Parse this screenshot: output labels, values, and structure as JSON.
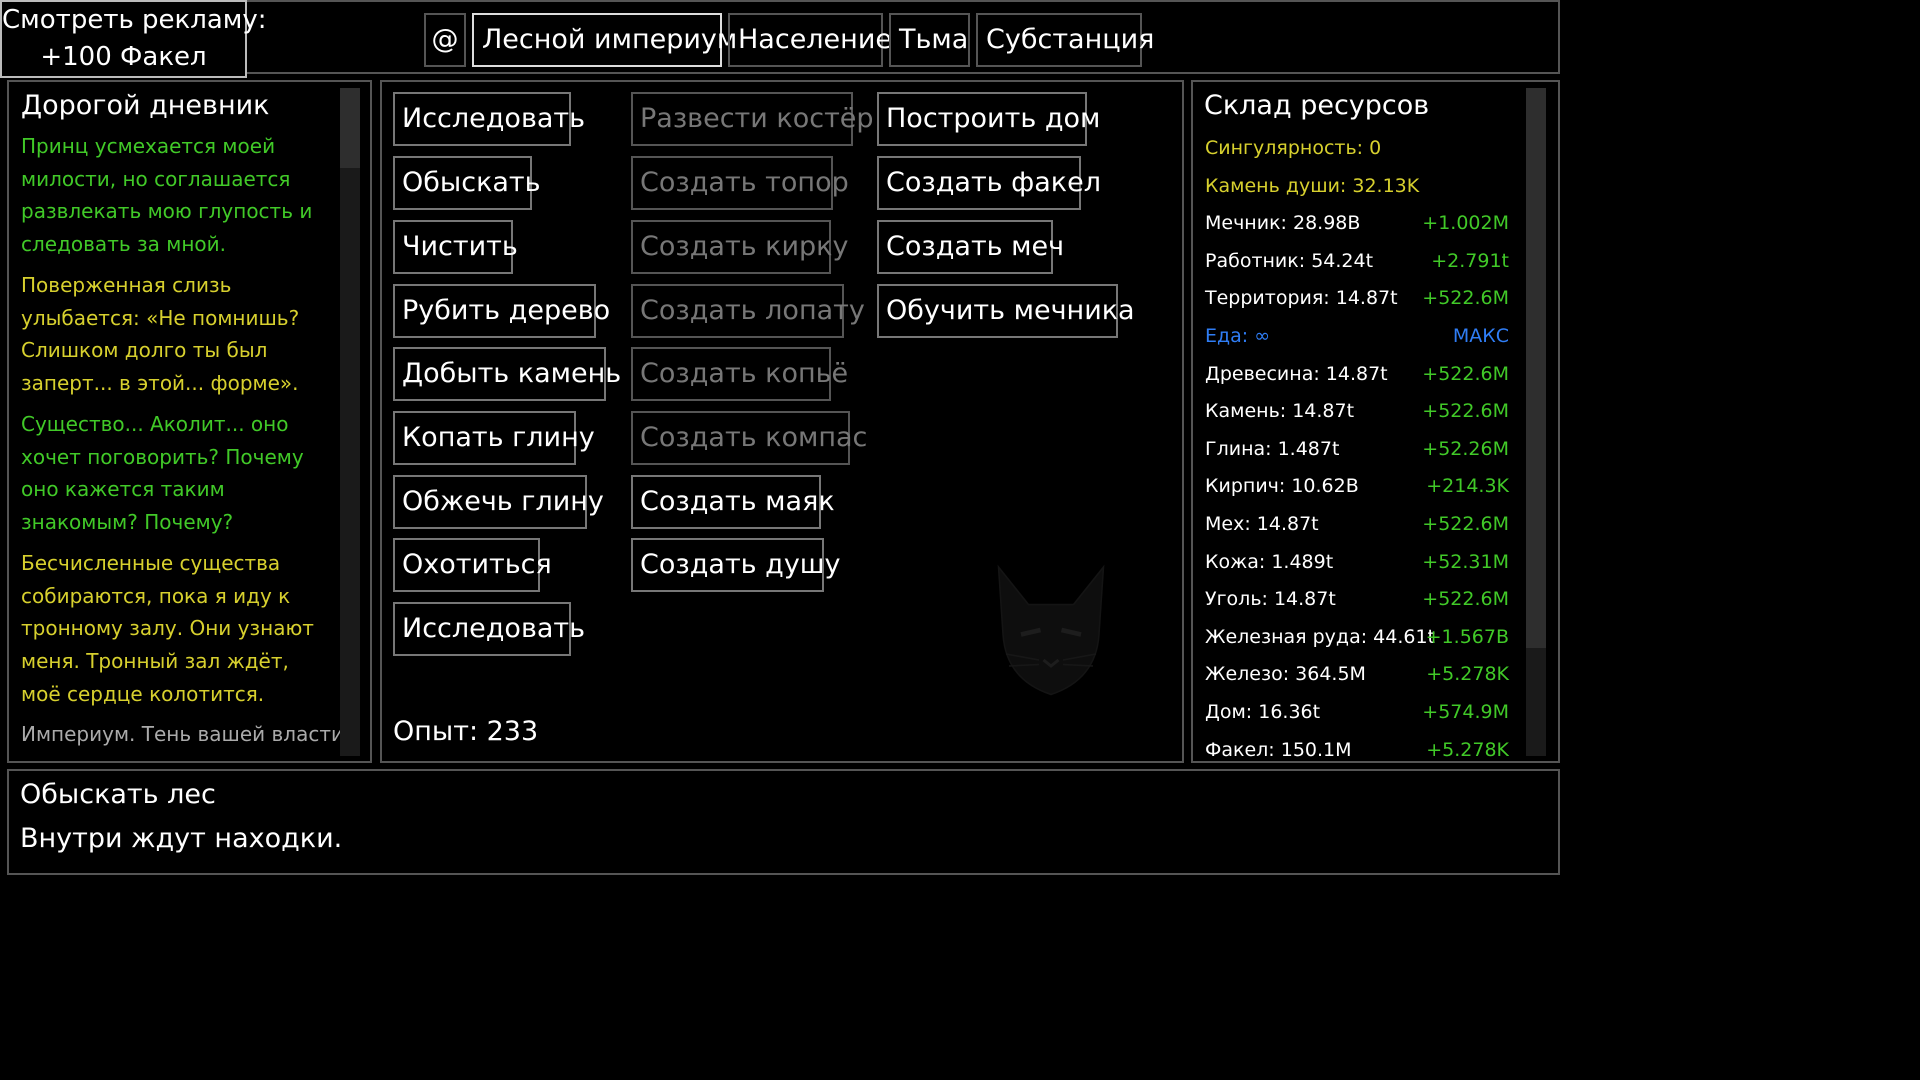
{
  "ad": {
    "line1": "Смотреть рекламу:",
    "line2": "+100 Факел"
  },
  "tabs": [
    {
      "label": "@"
    },
    {
      "label": "Лесной империум"
    },
    {
      "label": "Население"
    },
    {
      "label": "Тьма"
    },
    {
      "label": "Субстанция"
    }
  ],
  "diary": {
    "title": "Дорогой дневник",
    "entries": [
      {
        "text": "Принц усмехается моей милости, но соглашается развлекать мою глупость и следовать за мной."
      },
      {
        "text": "Поверженная слизь улыбается: «Не помнишь? Слишком долго ты был заперт... в этой... форме»."
      },
      {
        "text": "Существо... Аколит... оно хочет поговорить? Почему оно кажется таким знакомым? Почему?"
      },
      {
        "text": "Бесчисленные существа собираются, пока я иду к тронному залу. Они узнают меня. Тронный зал ждёт, моё сердце колотится."
      },
      {
        "text": "Империум. Тень вашей власти"
      }
    ]
  },
  "actions": {
    "col1": [
      "Исследовать",
      "Обыскать",
      "Чистить",
      "Рубить дерево",
      "Добыть камень",
      "Копать глину",
      "Обжечь глину",
      "Охотиться",
      "Исследовать"
    ],
    "col2": [
      "Развести костёр",
      "Создать топор",
      "Создать кирку",
      "Создать лопату",
      "Создать копьё",
      "Создать компас",
      "Создать маяк",
      "Создать душу"
    ],
    "col3": [
      "Построить дом",
      "Создать факел",
      "Создать меч",
      "Обучить мечника"
    ],
    "experience": "Опыт: 233"
  },
  "storage": {
    "title": "Склад ресурсов",
    "rows": [
      {
        "name": "Сингулярность: 0",
        "rate": ""
      },
      {
        "name": "Камень души: 32.13K",
        "rate": ""
      },
      {
        "name": "Мечник: 28.98B",
        "rate": "+1.002M"
      },
      {
        "name": "Работник: 54.24t",
        "rate": "+2.791t"
      },
      {
        "name": "Территория: 14.87t",
        "rate": "+522.6M"
      },
      {
        "name": "Еда: ∞",
        "rate": "МАКС"
      },
      {
        "name": "Древесина: 14.87t",
        "rate": "+522.6M"
      },
      {
        "name": "Камень: 14.87t",
        "rate": "+522.6M"
      },
      {
        "name": "Глина: 1.487t",
        "rate": "+52.26M"
      },
      {
        "name": "Кирпич: 10.62B",
        "rate": "+214.3K"
      },
      {
        "name": "Мех: 14.87t",
        "rate": "+522.6M"
      },
      {
        "name": "Кожа: 1.489t",
        "rate": "+52.31M"
      },
      {
        "name": "Уголь: 14.87t",
        "rate": "+522.6M"
      },
      {
        "name": "Железная руда: 44.61t",
        "rate": "+1.567B"
      },
      {
        "name": "Железо: 364.5M",
        "rate": "+5.278K"
      },
      {
        "name": "Дом: 16.36t",
        "rate": "+574.9M"
      },
      {
        "name": "Факел: 150.1M",
        "rate": "+5.278K"
      }
    ]
  },
  "info": {
    "title": "Обыскать лес",
    "description": "Внутри ждут находки."
  },
  "colors": {
    "green": "#41c928",
    "yellow": "#d7d02e",
    "blue": "#2f7df5",
    "disabled": "#777777"
  }
}
